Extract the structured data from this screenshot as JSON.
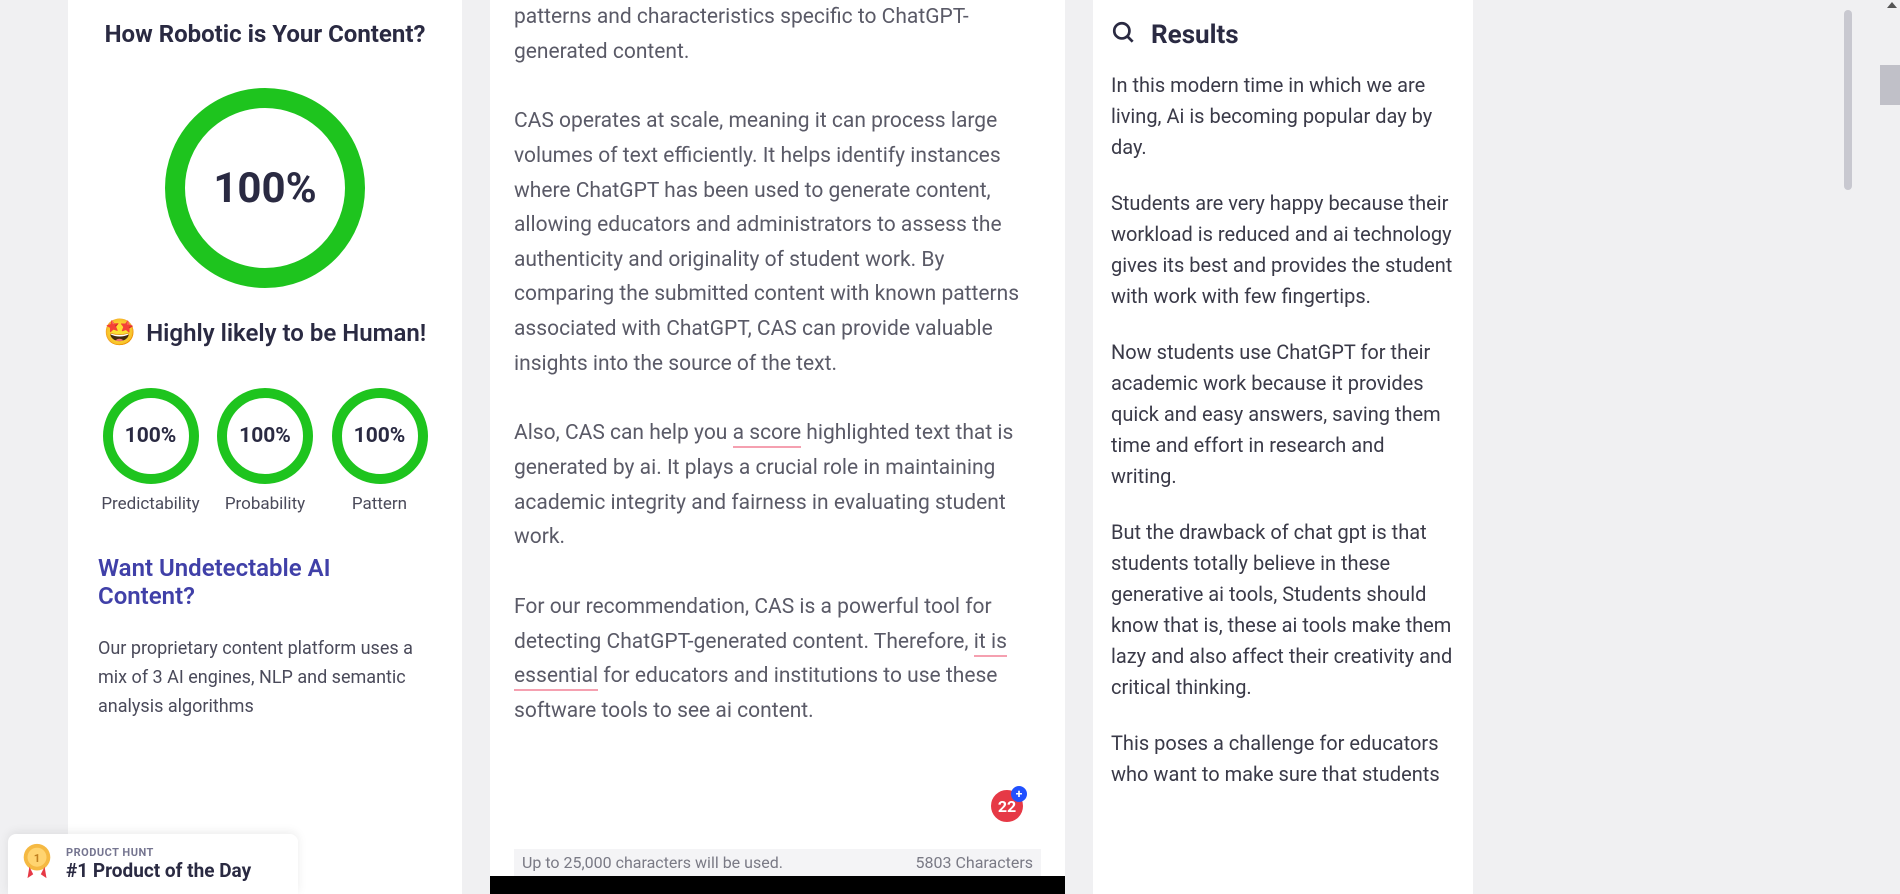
{
  "left": {
    "title": "How Robotic is Your Content?",
    "main_gauge": "100%",
    "likely_text": "Highly likely to be Human!",
    "emoji": "🤩",
    "gauges": [
      {
        "value": "100%",
        "label": "Predictability"
      },
      {
        "value": "100%",
        "label": "Probability"
      },
      {
        "value": "100%",
        "label": "Pattern"
      }
    ],
    "undetectable_title": "Want Undetectable AI Content?",
    "undetectable_text": "Our proprietary content platform uses a mix of 3 AI engines, NLP and semantic analysis algorithms"
  },
  "middle": {
    "para1": "patterns and characteristics specific to ChatGPT-generated content.",
    "para2": "CAS operates at scale, meaning it can process large volumes of text efficiently. It helps identify instances where ChatGPT has been used to generate content, allowing educators and administrators to assess the authenticity and originality of student work. By comparing the submitted content with known patterns associated with ChatGPT, CAS can provide valuable insights into the source of the text.",
    "para3_a": "Also, CAS can help you ",
    "para3_b": "a score",
    "para3_c": " highlighted text that is generated by ai. It plays a crucial role in maintaining academic integrity and fairness in evaluating student work.",
    "para4_a": "For our recommendation, CAS is a powerful tool for detecting ChatGPT-generated content.  Therefore, ",
    "para4_b": "it is essential",
    "para4_c": " for educators and institutions to use these software tools to see ai content.",
    "char_limit": "Up to 25,000 characters will be used.",
    "char_count": "5803 Characters",
    "badge_count": "22"
  },
  "right": {
    "title": "Results",
    "para1": "In this modern time in which we are living, Ai is becoming popular day by day.",
    "para2": "Students are very happy because their workload is reduced and ai technology gives its best and provides the student with work with few fingertips.",
    "para3": "Now students use ChatGPT for their academic work because it provides quick and easy answers, saving them time and effort in research and writing.",
    "para4": "But the drawback of chat gpt is that students totally believe in these generative ai tools, Students should know that is, these ai tools make them lazy and also affect their creativity and critical thinking.",
    "para5": "This poses a challenge for educators who want to make sure that students"
  },
  "product_hunt": {
    "label": "PRODUCT HUNT",
    "title": "#1 Product of the Day"
  }
}
